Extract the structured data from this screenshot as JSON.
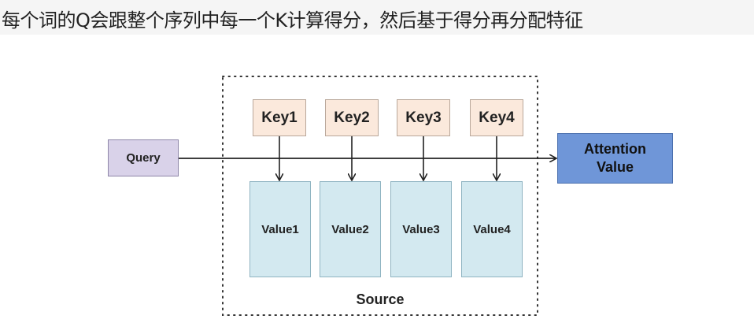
{
  "caption": "每个词的Q会跟整个序列中每一个K计算得分，然后基于得分再分配特征",
  "diagram": {
    "query": "Query",
    "keys": [
      "Key1",
      "Key2",
      "Key3",
      "Key4"
    ],
    "values": [
      "Value1",
      "Value2",
      "Value3",
      "Value4"
    ],
    "output_line1": "Attention",
    "output_line2": "Value",
    "container_label": "Source"
  },
  "colors": {
    "query_fill": "#d9d2e9",
    "key_fill": "#fbe9dc",
    "value_fill": "#d3e9f0",
    "output_fill": "#6f96d8"
  }
}
